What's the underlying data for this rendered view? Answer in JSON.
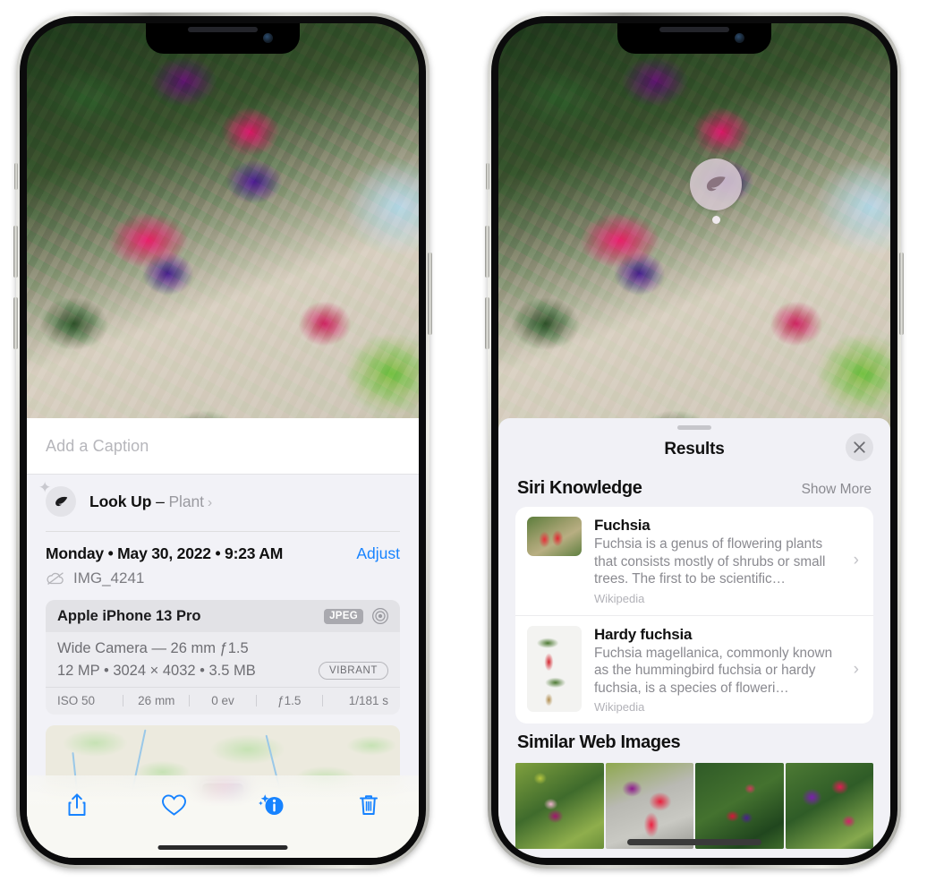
{
  "left_phone": {
    "name": "iphone-photos-info",
    "caption": {
      "placeholder": "Add a Caption",
      "value": ""
    },
    "lookup": {
      "icon": "leaf-icon",
      "sparkle_icon": "sparkle-icon",
      "label": "Look Up",
      "dash": "–",
      "subject": "Plant",
      "chevron": "›"
    },
    "meta": {
      "date": "Monday • May 30, 2022 • 9:23 AM",
      "adjust_label": "Adjust",
      "cloud_icon": "cloud-slash-icon",
      "filename": "IMG_4241"
    },
    "exif": {
      "device": "Apple iPhone 13 Pro",
      "format_badge": "JPEG",
      "aperture_icon": "aperture-icon",
      "lens_line": "Wide Camera — 26 mm ƒ1.5",
      "size_line": "12 MP • 3024 × 4032 • 3.5 MB",
      "style_badge": "VIBRANT",
      "stats": [
        "ISO 50",
        "26 mm",
        "0 ev",
        "ƒ1.5",
        "1/181 s"
      ]
    },
    "map": {
      "name": "location-map-preview",
      "pin": "photo-location-thumbnail"
    },
    "toolbar": [
      {
        "name": "share-icon",
        "label": "Share"
      },
      {
        "name": "heart-icon",
        "label": "Favorite"
      },
      {
        "name": "info-sparkle-icon",
        "label": "Info"
      },
      {
        "name": "trash-icon",
        "label": "Delete"
      }
    ],
    "accent_color": "#1783ff"
  },
  "right_phone": {
    "name": "iphone-visual-lookup-results",
    "photo_pin": {
      "icon": "leaf-icon",
      "label": "Visual Look Up marker"
    },
    "sheet": {
      "grabber": "sheet-grabber",
      "title": "Results",
      "close_icon": "close-icon"
    },
    "siri_knowledge": {
      "title": "Siri Knowledge",
      "action": "Show More",
      "items": [
        {
          "title": "Fuchsia",
          "description": "Fuchsia is a genus of flowering plants that consists mostly of shrubs or small trees. The first to be scientific…",
          "source": "Wikipedia",
          "thumb": "fuchsia-red-flowers-thumbnail",
          "chevron": "›"
        },
        {
          "title": "Hardy fuchsia",
          "description": "Fuchsia magellanica, commonly known as the hummingbird fuchsia or hardy fuchsia, is a species of floweri…",
          "source": "Wikipedia",
          "thumb": "hardy-fuchsia-branch-thumbnail",
          "chevron": "›"
        }
      ]
    },
    "similar_web_images": {
      "title": "Similar Web Images",
      "items": [
        {
          "name": "similar-image-1",
          "alt": "purple and pink fuchsia bloom with leaves"
        },
        {
          "name": "similar-image-2",
          "alt": "close-up red and magenta fuchsia petals"
        },
        {
          "name": "similar-image-3",
          "alt": "fuchsia shrub with many buds"
        },
        {
          "name": "similar-image-4",
          "alt": "purple and red fuchsia cluster"
        }
      ]
    }
  }
}
